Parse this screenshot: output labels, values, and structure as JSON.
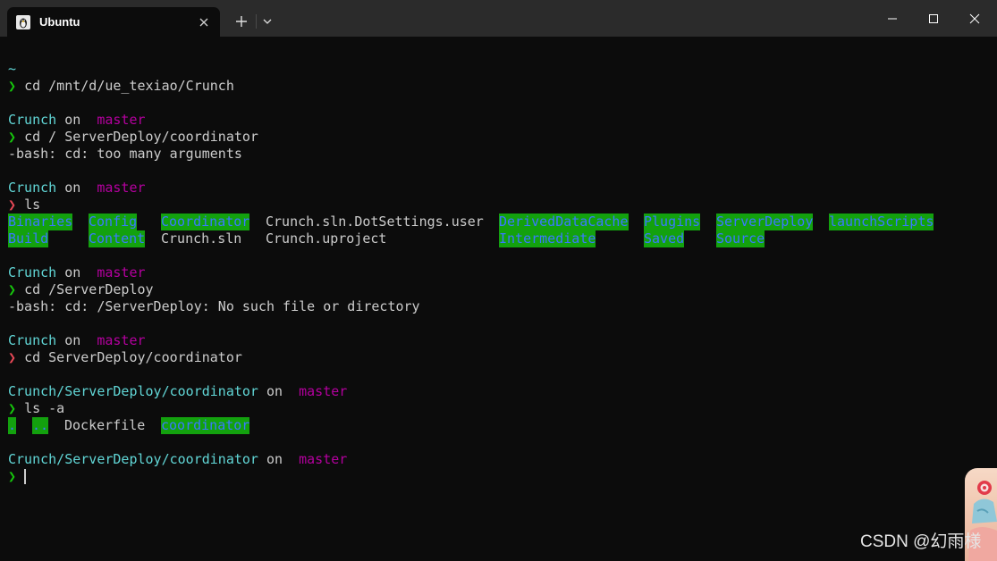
{
  "window": {
    "tab_title": "Ubuntu",
    "tab_icon": "linux-penguin-icon",
    "controls": [
      "minimize-icon",
      "maximize-icon",
      "close-icon"
    ]
  },
  "colors": {
    "background": "#0c0c0c",
    "titlebar": "#2b2b2b",
    "path_cyan": "#61d6d6",
    "branch_magenta": "#b4009e",
    "prompt_green": "#16c60c",
    "prompt_red": "#e74856",
    "dir_highlight_bg": "#13a10e",
    "dir_highlight_fg": "#3b78ff"
  },
  "terminal": {
    "home": "~",
    "prompt_symbol": "❯",
    "on_word": "on",
    "branch_symbol": "",
    "branch": "master",
    "cmd1": "cd /mnt/d/ue_texiao/Crunch",
    "block2_dir": "Crunch",
    "cmd2": "cd / ServerDeploy/coordinator",
    "err2": "-bash: cd: too many arguments",
    "block3_dir": "Crunch",
    "cmd3": "ls",
    "ls_row1": [
      "Binaries",
      "Config",
      "Coordinator",
      "Crunch.sln.DotSettings.user",
      "DerivedDataCache",
      "Plugins",
      "ServerDeploy",
      "launchScripts"
    ],
    "ls_row2": [
      "Build",
      "Content",
      "Crunch.sln",
      "Crunch.uproject",
      "Intermediate",
      "Saved",
      "Source"
    ],
    "block4_dir": "Crunch",
    "cmd4": "cd /ServerDeploy",
    "err4": "-bash: cd: /ServerDeploy: No such file or directory",
    "block5_dir": "Crunch",
    "cmd5": "cd ServerDeploy/coordinator",
    "block6_dir": "Crunch/ServerDeploy/coordinator",
    "cmd6": "ls -a",
    "ls_a": [
      ".",
      "..",
      "Dockerfile",
      "coordinator"
    ],
    "block7_dir": "Crunch/ServerDeploy/coordinator"
  },
  "watermark": "CSDN @幻雨様"
}
